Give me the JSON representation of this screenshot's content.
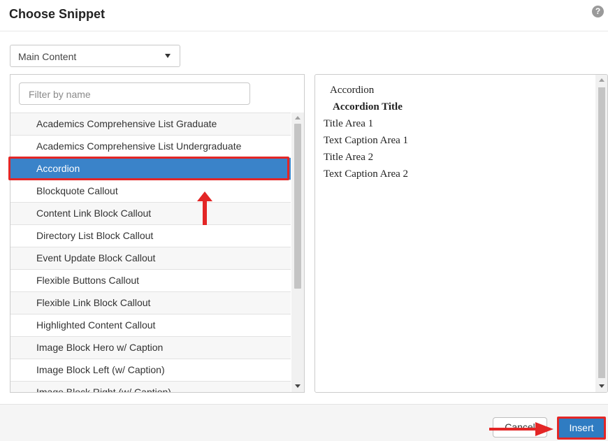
{
  "dialog": {
    "title": "Choose Snippet",
    "help_icon": "?"
  },
  "category_select": {
    "value": "Main Content"
  },
  "filter": {
    "placeholder": "Filter by name"
  },
  "snippets": [
    "Academics Comprehensive List Graduate",
    "Academics Comprehensive List Undergraduate",
    "Accordion",
    "Blockquote Callout",
    "Content Link Block Callout",
    "Directory List Block Callout",
    "Event Update Block Callout",
    "Flexible Buttons Callout",
    "Flexible Link Block Callout",
    "Highlighted Content Callout",
    "Image Block Hero w/ Caption",
    "Image Block Left (w/ Caption)",
    "Image Block Right (w/ Caption)"
  ],
  "selected_snippet": "Accordion",
  "preview": {
    "lines": [
      {
        "text": "Accordion",
        "style": "indent"
      },
      {
        "text": "Accordion Title",
        "style": "bold"
      },
      {
        "text": "Title Area 1",
        "style": "normal"
      },
      {
        "text": "Text Caption Area 1",
        "style": "normal"
      },
      {
        "text": "Title Area 2",
        "style": "normal"
      },
      {
        "text": "Text Caption Area 2",
        "style": "normal"
      }
    ]
  },
  "footer": {
    "cancel_label": "Cancel",
    "insert_label": "Insert"
  },
  "colors": {
    "selected_row": "#3a83c9",
    "annotation_red": "#e32626",
    "insert_button": "#2f7cc2"
  }
}
